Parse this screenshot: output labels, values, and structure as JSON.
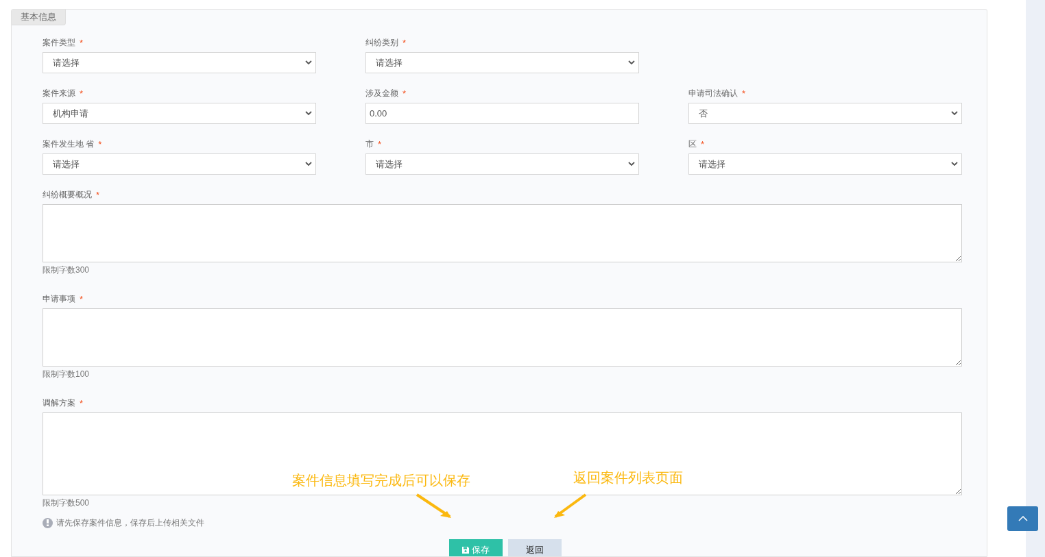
{
  "panel": {
    "tab": "基本信息"
  },
  "field_rows": [
    [
      {
        "label": "案件类型",
        "required_mark": "*",
        "kind": "select",
        "value": "请选择"
      },
      {
        "label": "纠纷类别",
        "required_mark": "*",
        "kind": "select",
        "value": "请选择"
      }
    ],
    [
      {
        "label": "案件来源",
        "required_mark": "*",
        "kind": "select",
        "value": "机构申请"
      },
      {
        "label": "涉及金额",
        "required_mark": "*",
        "kind": "input",
        "value": "0.00"
      },
      {
        "label": "申请司法确认",
        "required_mark": "*",
        "kind": "select",
        "value": "否"
      }
    ],
    [
      {
        "label": "案件发生地 省",
        "required_mark": "*",
        "kind": "select",
        "value": "请选择"
      },
      {
        "label": "市",
        "required_mark": "*",
        "kind": "select",
        "value": "请选择"
      },
      {
        "label": "区",
        "required_mark": "*",
        "kind": "select",
        "value": "请选择"
      }
    ]
  ],
  "textareas": [
    {
      "label": "纠纷概要概况",
      "required_mark": "*",
      "hint": "限制字数300",
      "kind": "short"
    },
    {
      "label": "申请事项",
      "required_mark": "*",
      "hint": "限制字数100",
      "kind": "short"
    },
    {
      "label": "调解方案",
      "required_mark": "*",
      "hint": "限制字数500",
      "kind": "tall"
    }
  ],
  "notice": "请先保存案件信息，保存后上传相关文件",
  "buttons": [
    {
      "label": "保存",
      "kind": "primary"
    },
    {
      "label": "返回",
      "kind": "secondary"
    }
  ],
  "annotations": [
    {
      "text": "案件信息填写完成后可以保存"
    },
    {
      "text": "返回案件列表页面"
    }
  ]
}
